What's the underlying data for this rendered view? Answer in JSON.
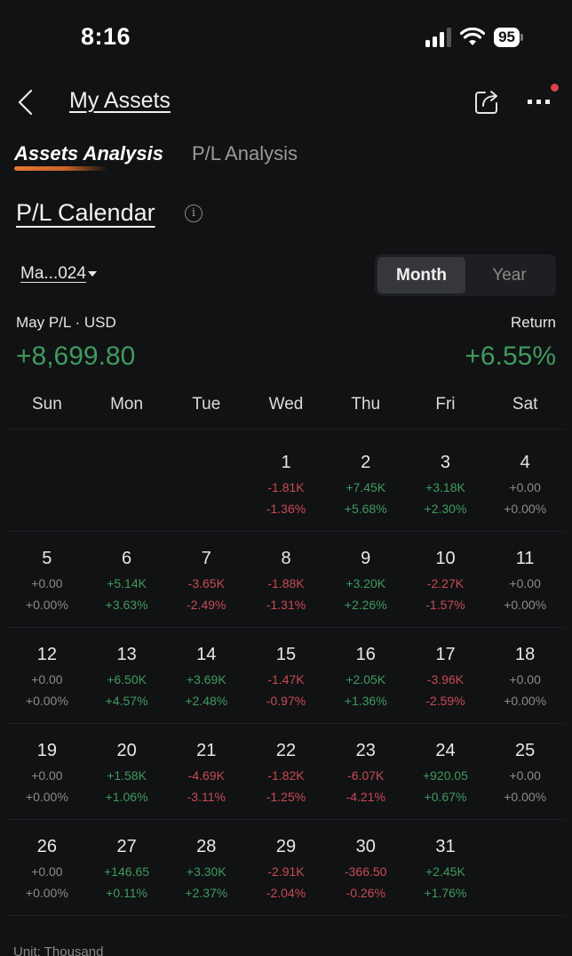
{
  "status_bar": {
    "time": "8:16",
    "battery": "95",
    "icons": [
      "cellular-signal-icon",
      "wifi-icon",
      "battery-icon"
    ]
  },
  "nav": {
    "back_icon": "chevron-left-icon",
    "title": "My Assets",
    "share_icon": "share-icon",
    "more_icon": "more-dots-icon",
    "has_notification": true
  },
  "tabs": [
    {
      "label": "Assets Analysis",
      "active": true
    },
    {
      "label": "P/L Analysis",
      "active": false
    }
  ],
  "section": {
    "title": "P/L Calendar",
    "info_icon": "info-icon"
  },
  "controls": {
    "date_picker_label": "Ma...024",
    "segments": [
      {
        "label": "Month",
        "active": true
      },
      {
        "label": "Year",
        "active": false
      }
    ]
  },
  "summary": {
    "pl_label": "May P/L · USD",
    "pl_value": "+8,699.80",
    "return_label": "Return",
    "return_value": "+6.55%"
  },
  "colors": {
    "positive": "#3f9a5e",
    "negative": "#c94a54",
    "neutral": "#8a8a8a",
    "accent": "#e8772e",
    "background": "#111214"
  },
  "calendar": {
    "weekdays": [
      "Sun",
      "Mon",
      "Tue",
      "Wed",
      "Thu",
      "Fri",
      "Sat"
    ],
    "weeks": [
      [
        null,
        null,
        null,
        {
          "day": "1",
          "pl": "-1.81K",
          "ret": "-1.36%",
          "sign": "neg"
        },
        {
          "day": "2",
          "pl": "+7.45K",
          "ret": "+5.68%",
          "sign": "pos"
        },
        {
          "day": "3",
          "pl": "+3.18K",
          "ret": "+2.30%",
          "sign": "pos"
        },
        {
          "day": "4",
          "pl": "+0.00",
          "ret": "+0.00%",
          "sign": "zero"
        }
      ],
      [
        {
          "day": "5",
          "pl": "+0.00",
          "ret": "+0.00%",
          "sign": "zero"
        },
        {
          "day": "6",
          "pl": "+5.14K",
          "ret": "+3.63%",
          "sign": "pos"
        },
        {
          "day": "7",
          "pl": "-3.65K",
          "ret": "-2.49%",
          "sign": "neg"
        },
        {
          "day": "8",
          "pl": "-1.88K",
          "ret": "-1.31%",
          "sign": "neg"
        },
        {
          "day": "9",
          "pl": "+3.20K",
          "ret": "+2.26%",
          "sign": "pos"
        },
        {
          "day": "10",
          "pl": "-2.27K",
          "ret": "-1.57%",
          "sign": "neg"
        },
        {
          "day": "11",
          "pl": "+0.00",
          "ret": "+0.00%",
          "sign": "zero"
        }
      ],
      [
        {
          "day": "12",
          "pl": "+0.00",
          "ret": "+0.00%",
          "sign": "zero"
        },
        {
          "day": "13",
          "pl": "+6.50K",
          "ret": "+4.57%",
          "sign": "pos"
        },
        {
          "day": "14",
          "pl": "+3.69K",
          "ret": "+2.48%",
          "sign": "pos"
        },
        {
          "day": "15",
          "pl": "-1.47K",
          "ret": "-0.97%",
          "sign": "neg"
        },
        {
          "day": "16",
          "pl": "+2.05K",
          "ret": "+1.36%",
          "sign": "pos"
        },
        {
          "day": "17",
          "pl": "-3.96K",
          "ret": "-2.59%",
          "sign": "neg"
        },
        {
          "day": "18",
          "pl": "+0.00",
          "ret": "+0.00%",
          "sign": "zero"
        }
      ],
      [
        {
          "day": "19",
          "pl": "+0.00",
          "ret": "+0.00%",
          "sign": "zero"
        },
        {
          "day": "20",
          "pl": "+1.58K",
          "ret": "+1.06%",
          "sign": "pos"
        },
        {
          "day": "21",
          "pl": "-4.69K",
          "ret": "-3.11%",
          "sign": "neg"
        },
        {
          "day": "22",
          "pl": "-1.82K",
          "ret": "-1.25%",
          "sign": "neg"
        },
        {
          "day": "23",
          "pl": "-6.07K",
          "ret": "-4.21%",
          "sign": "neg"
        },
        {
          "day": "24",
          "pl": "+920.05",
          "ret": "+0.67%",
          "sign": "pos"
        },
        {
          "day": "25",
          "pl": "+0.00",
          "ret": "+0.00%",
          "sign": "zero"
        }
      ],
      [
        {
          "day": "26",
          "pl": "+0.00",
          "ret": "+0.00%",
          "sign": "zero"
        },
        {
          "day": "27",
          "pl": "+146.65",
          "ret": "+0.11%",
          "sign": "pos"
        },
        {
          "day": "28",
          "pl": "+3.30K",
          "ret": "+2.37%",
          "sign": "pos"
        },
        {
          "day": "29",
          "pl": "-2.91K",
          "ret": "-2.04%",
          "sign": "neg"
        },
        {
          "day": "30",
          "pl": "-366.50",
          "ret": "-0.26%",
          "sign": "neg"
        },
        {
          "day": "31",
          "pl": "+2.45K",
          "ret": "+1.76%",
          "sign": "pos"
        },
        null
      ]
    ]
  },
  "footer": {
    "unit_note": "Unit: Thousand"
  }
}
